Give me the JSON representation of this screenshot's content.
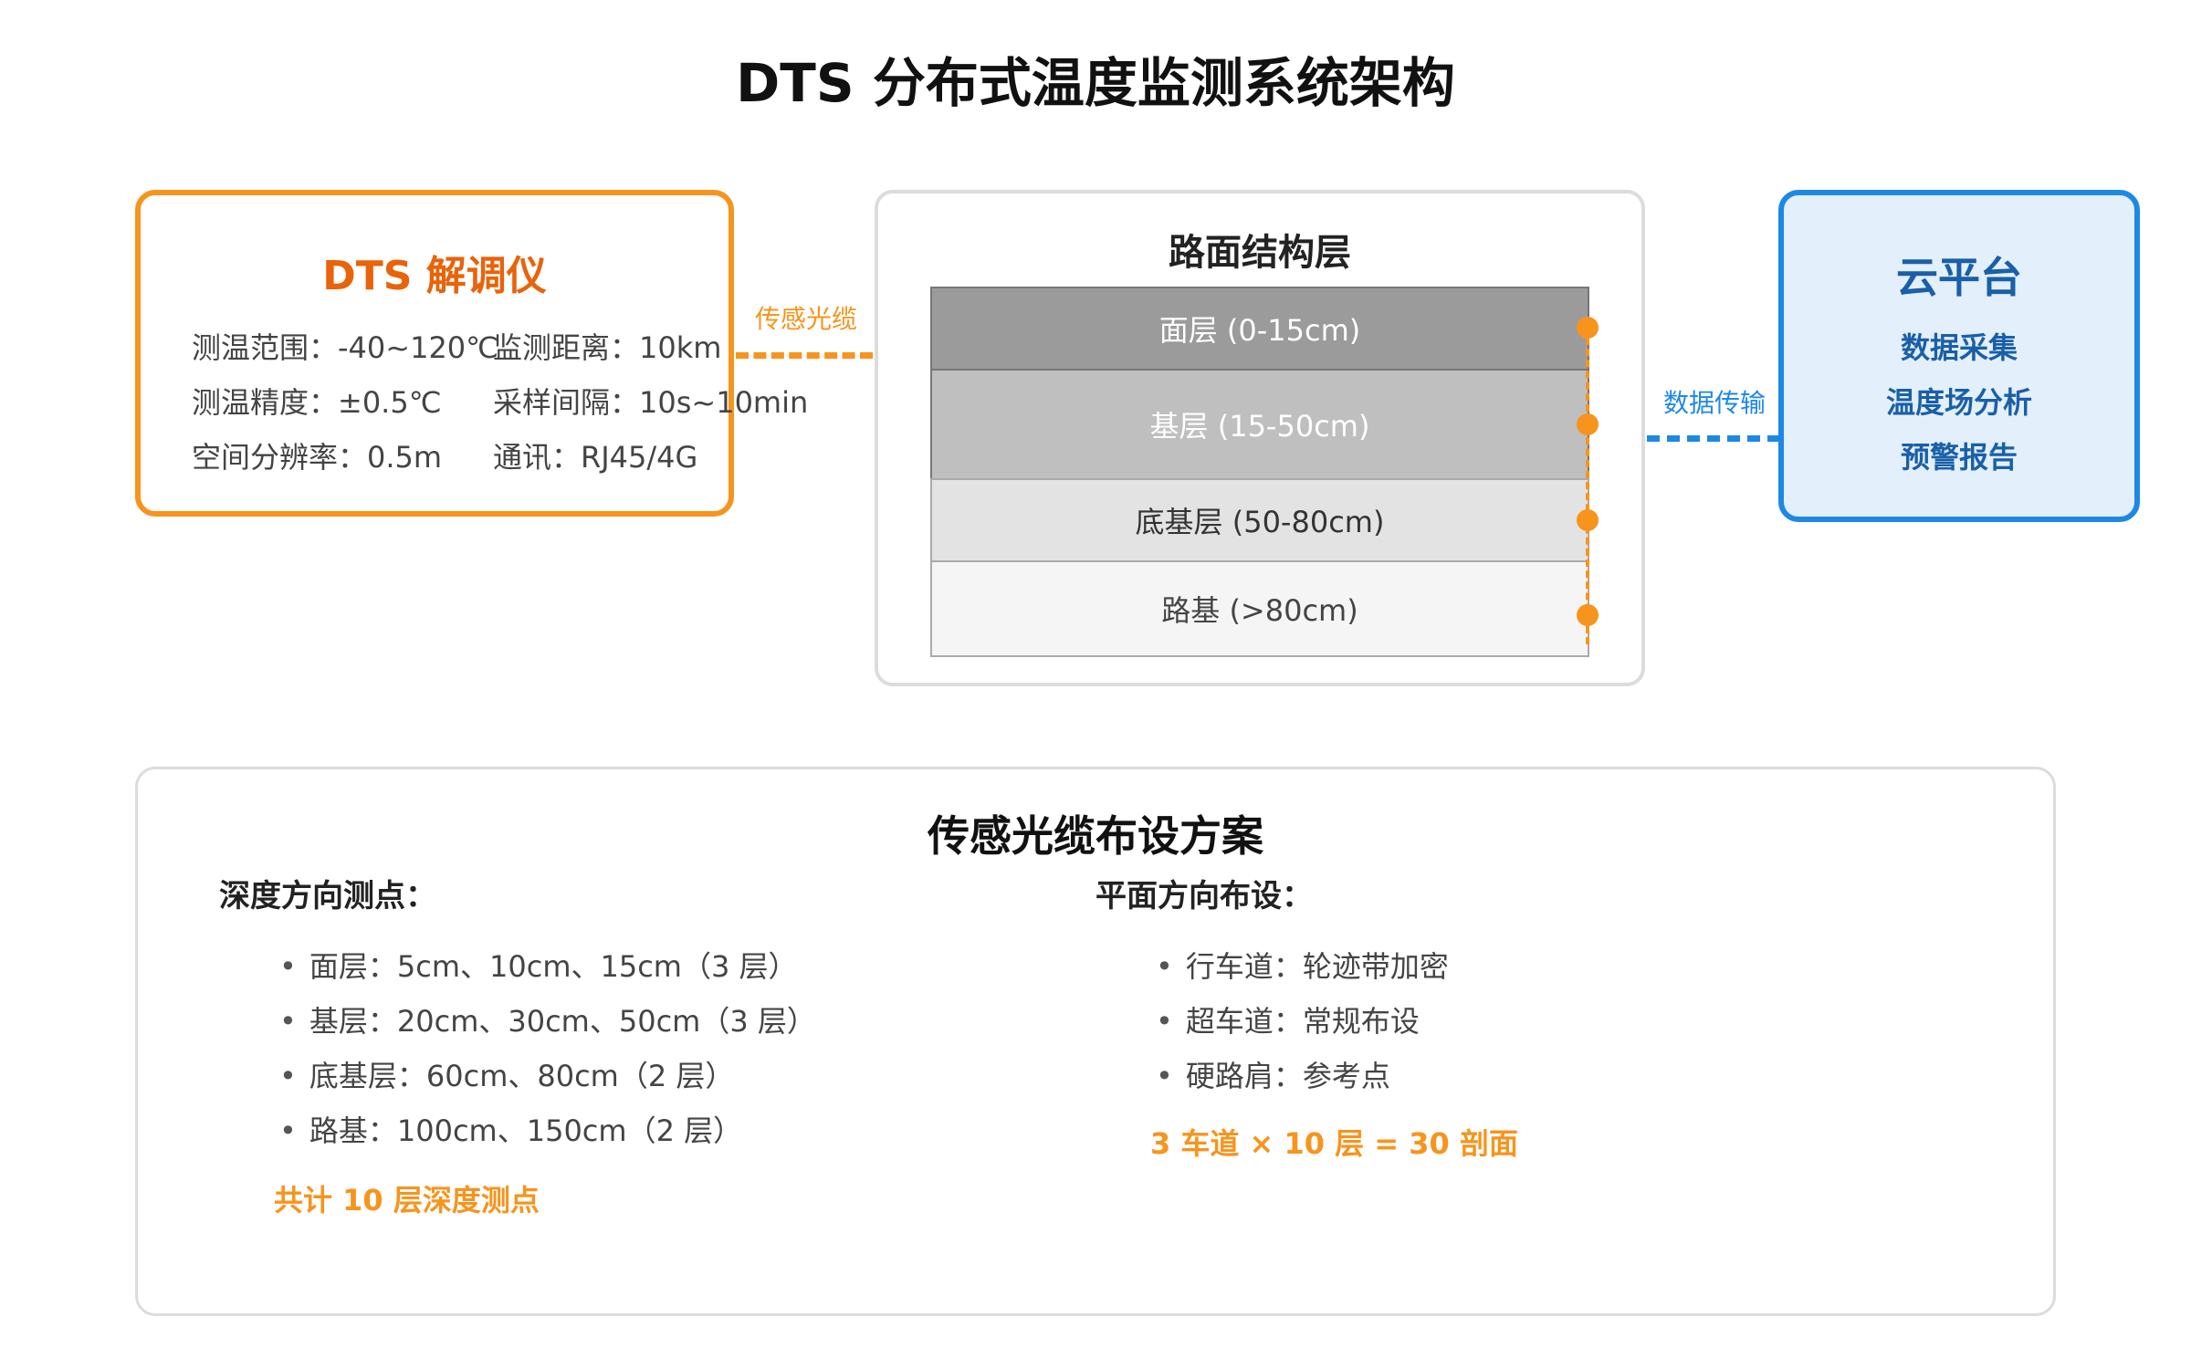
{
  "title": "DTS 分布式温度监测系统架构",
  "dts": {
    "title": "DTS 解调仪",
    "specs": [
      "测温范围：-40~120℃",
      "监测距离：10km",
      "测温精度：±0.5℃",
      "采样间隔：10s~10min",
      "空间分辨率：0.5m",
      "通讯：RJ45/4G"
    ]
  },
  "connectors": {
    "left_label": "传感光缆",
    "right_label": "数据传输"
  },
  "road": {
    "title": "路面结构层",
    "layers": [
      "面层 (0-15cm)",
      "基层 (15-50cm)",
      "底基层 (50-80cm)",
      "路基 (>80cm)"
    ]
  },
  "cloud": {
    "title": "云平台",
    "items": [
      "数据采集",
      "温度场分析",
      "预警报告"
    ]
  },
  "plan": {
    "title": "传感光缆布设方案",
    "depth": {
      "heading": "深度方向测点：",
      "items": [
        "面层：5cm、10cm、15cm（3 层）",
        "基层：20cm、30cm、50cm（3 层）",
        "底基层：60cm、80cm（2 层）",
        "路基：100cm、150cm（2 层）"
      ],
      "summary": "共计 10 层深度测点"
    },
    "plane": {
      "heading": "平面方向布设：",
      "items": [
        "行车道：轮迹带加密",
        "超车道：常规布设",
        "硬路肩：参考点"
      ],
      "summary": "3 车道 × 10 层 = 30 剖面"
    },
    "bullet": "•"
  },
  "colors": {
    "orange": "#f7941d",
    "orange_text": "#e8630a",
    "blue": "#1e88e5",
    "blue_text": "#1a5fa8"
  }
}
